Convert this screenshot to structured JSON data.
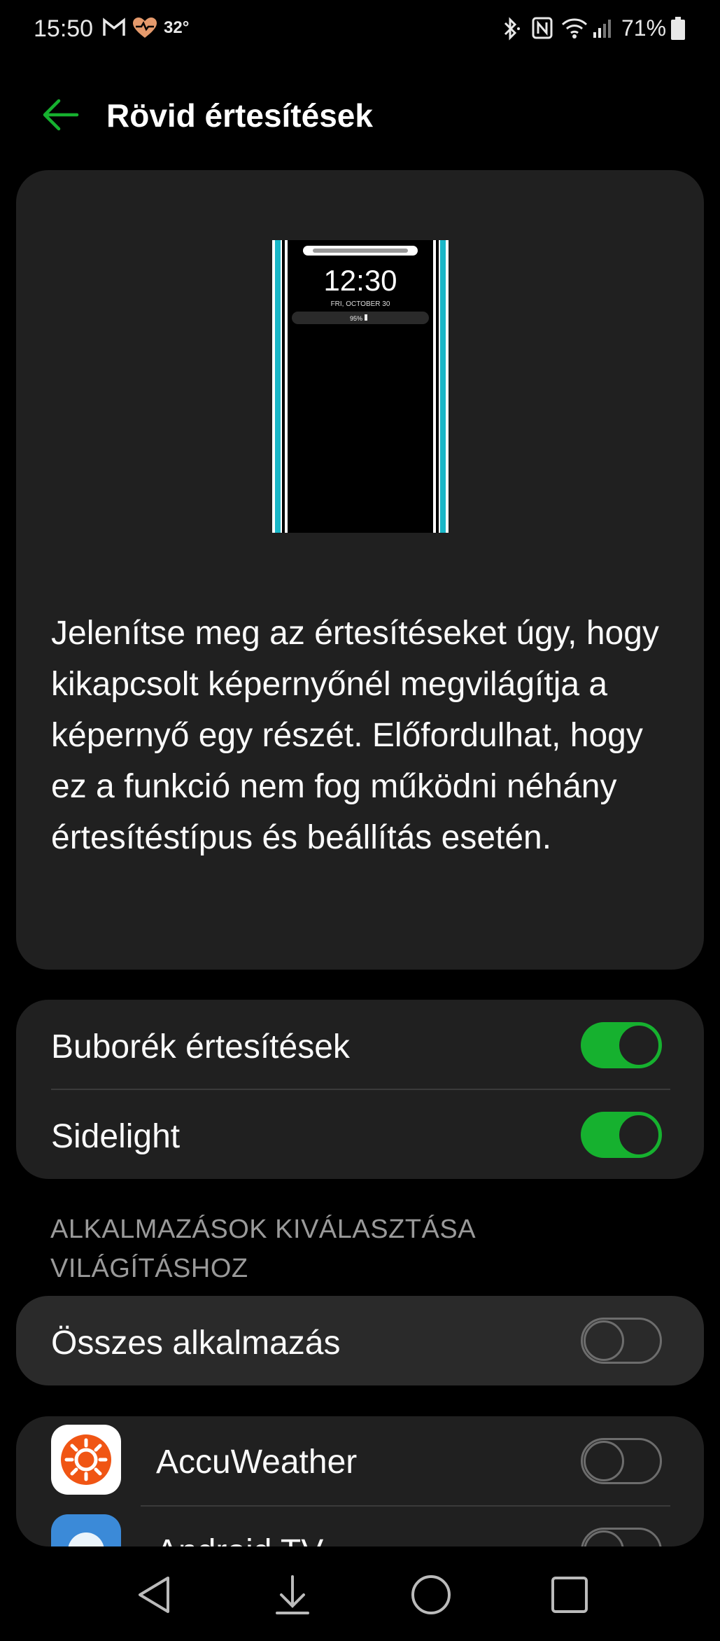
{
  "status_bar": {
    "time": "15:50",
    "temperature": "32°",
    "battery_percent": "71%",
    "icons": [
      "gmail-icon",
      "health-heart-icon",
      "bluetooth-icon",
      "nfc-icon",
      "wifi-icon",
      "cell-signal-icon",
      "battery-icon"
    ]
  },
  "header": {
    "title": "Rövid értesítések",
    "back_icon": "arrow-left-icon",
    "accent_color": "#16b12f"
  },
  "preview": {
    "time": "12:30",
    "date": "FRI, OCTOBER 30",
    "battery": "95%",
    "edge_color": "#19b7c8"
  },
  "description": "Jelenítse meg az értesítéseket úgy, hogy kikapcsolt képernyőnél megvilágítja a képernyő egy részét. Előfordulhat, hogy ez a funkció nem fog működni néhány értesítéstípus és beállítás esetén.",
  "settings": [
    {
      "label": "Buborék értesítések",
      "enabled": true
    },
    {
      "label": "Sidelight",
      "enabled": true
    }
  ],
  "section_header_line1": "ALKALMAZÁSOK KIVÁLASZTÁSA",
  "section_header_line2": "VILÁGÍTÁSHOZ",
  "all_apps": {
    "label": "Összes alkalmazás",
    "enabled": false
  },
  "apps": [
    {
      "label": "AccuWeather",
      "icon": "accuweather-icon",
      "enabled": false
    },
    {
      "label": "Android TV",
      "icon": "android-tv-icon",
      "enabled": false
    }
  ],
  "nav": [
    "back-nav-icon",
    "notification-pull-icon",
    "home-nav-icon",
    "recents-nav-icon"
  ]
}
